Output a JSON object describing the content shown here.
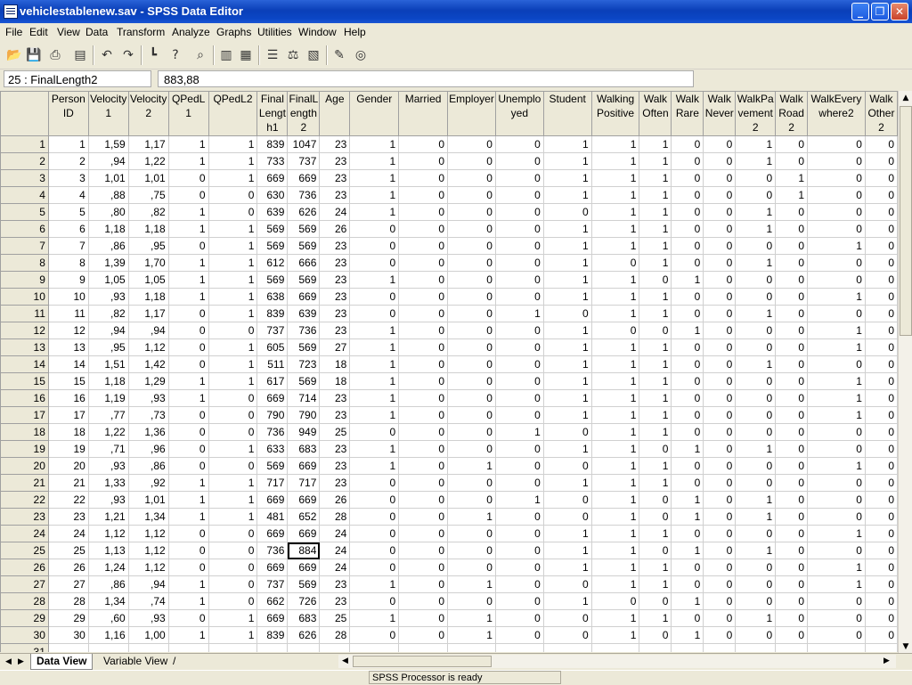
{
  "window": {
    "title": "vehiclestablenew.sav - SPSS Data Editor",
    "minimize": "_",
    "restore": "❐",
    "close": "✕"
  },
  "menu": [
    "File",
    "Edit",
    "View",
    "Data",
    "Transform",
    "Analyze",
    "Graphs",
    "Utilities",
    "Window",
    "Help"
  ],
  "editor": {
    "cell_ref": "25 : FinalLength2",
    "cell_value": "883,88"
  },
  "columns": [
    {
      "name": "Person ID",
      "w": 45
    },
    {
      "name": "Velocity1",
      "w": 45
    },
    {
      "name": "Velocity2",
      "w": 45
    },
    {
      "name": "QPedL1",
      "w": 45
    },
    {
      "name": "QPedL2",
      "w": 55
    },
    {
      "name": "FinalLength1",
      "w": 34
    },
    {
      "name": "FinalLength2",
      "w": 36
    },
    {
      "name": "Age",
      "w": 34
    },
    {
      "name": "Gender",
      "w": 55
    },
    {
      "name": "Married",
      "w": 55
    },
    {
      "name": "Employer",
      "w": 54
    },
    {
      "name": "Unemployed",
      "w": 54
    },
    {
      "name": "Student",
      "w": 54
    },
    {
      "name": "Walking Positive",
      "w": 54
    },
    {
      "name": "Walk Often",
      "w": 36
    },
    {
      "name": "Walk Rare",
      "w": 36
    },
    {
      "name": "Walk Never",
      "w": 36
    },
    {
      "name": "WalkPavement2",
      "w": 45
    },
    {
      "name": "Walk Road2",
      "w": 36
    },
    {
      "name": "WalkEverywhere2",
      "w": 65
    },
    {
      "name": "Walk Other2",
      "w": 36
    }
  ],
  "rows": [
    [
      "1",
      "1,59",
      "1,17",
      "1",
      "1",
      "839",
      "1047",
      "23",
      "1",
      "0",
      "0",
      "0",
      "1",
      "1",
      "1",
      "0",
      "0",
      "1",
      "0",
      "0",
      "0"
    ],
    [
      "2",
      ",94",
      "1,22",
      "1",
      "1",
      "733",
      "737",
      "23",
      "1",
      "0",
      "0",
      "0",
      "1",
      "1",
      "1",
      "0",
      "0",
      "1",
      "0",
      "0",
      "0"
    ],
    [
      "3",
      "1,01",
      "1,01",
      "0",
      "1",
      "669",
      "669",
      "23",
      "1",
      "0",
      "0",
      "0",
      "1",
      "1",
      "1",
      "0",
      "0",
      "0",
      "1",
      "0",
      "0"
    ],
    [
      "4",
      ",88",
      ",75",
      "0",
      "0",
      "630",
      "736",
      "23",
      "1",
      "0",
      "0",
      "0",
      "1",
      "1",
      "1",
      "0",
      "0",
      "0",
      "1",
      "0",
      "0"
    ],
    [
      "5",
      ",80",
      ",82",
      "1",
      "0",
      "639",
      "626",
      "24",
      "1",
      "0",
      "0",
      "0",
      "0",
      "1",
      "1",
      "0",
      "0",
      "1",
      "0",
      "0",
      "0"
    ],
    [
      "6",
      "1,18",
      "1,18",
      "1",
      "1",
      "569",
      "569",
      "26",
      "0",
      "0",
      "0",
      "0",
      "1",
      "1",
      "1",
      "0",
      "0",
      "1",
      "0",
      "0",
      "0"
    ],
    [
      "7",
      ",86",
      ",95",
      "0",
      "1",
      "569",
      "569",
      "23",
      "0",
      "0",
      "0",
      "0",
      "1",
      "1",
      "1",
      "0",
      "0",
      "0",
      "0",
      "1",
      "0"
    ],
    [
      "8",
      "1,39",
      "1,70",
      "1",
      "1",
      "612",
      "666",
      "23",
      "0",
      "0",
      "0",
      "0",
      "1",
      "0",
      "1",
      "0",
      "0",
      "1",
      "0",
      "0",
      "0"
    ],
    [
      "9",
      "1,05",
      "1,05",
      "1",
      "1",
      "569",
      "569",
      "23",
      "1",
      "0",
      "0",
      "0",
      "1",
      "1",
      "0",
      "1",
      "0",
      "0",
      "0",
      "0",
      "0"
    ],
    [
      "10",
      ",93",
      "1,18",
      "1",
      "1",
      "638",
      "669",
      "23",
      "0",
      "0",
      "0",
      "0",
      "1",
      "1",
      "1",
      "0",
      "0",
      "0",
      "0",
      "1",
      "0"
    ],
    [
      "11",
      ",82",
      "1,17",
      "0",
      "1",
      "839",
      "639",
      "23",
      "0",
      "0",
      "0",
      "1",
      "0",
      "1",
      "1",
      "0",
      "0",
      "1",
      "0",
      "0",
      "0"
    ],
    [
      "12",
      ",94",
      ",94",
      "0",
      "0",
      "737",
      "736",
      "23",
      "1",
      "0",
      "0",
      "0",
      "1",
      "0",
      "0",
      "1",
      "0",
      "0",
      "0",
      "1",
      "0"
    ],
    [
      "13",
      ",95",
      "1,12",
      "0",
      "1",
      "605",
      "569",
      "27",
      "1",
      "0",
      "0",
      "0",
      "1",
      "1",
      "1",
      "0",
      "0",
      "0",
      "0",
      "1",
      "0"
    ],
    [
      "14",
      "1,51",
      "1,42",
      "0",
      "1",
      "511",
      "723",
      "18",
      "1",
      "0",
      "0",
      "0",
      "1",
      "1",
      "1",
      "0",
      "0",
      "1",
      "0",
      "0",
      "0"
    ],
    [
      "15",
      "1,18",
      "1,29",
      "1",
      "1",
      "617",
      "569",
      "18",
      "1",
      "0",
      "0",
      "0",
      "1",
      "1",
      "1",
      "0",
      "0",
      "0",
      "0",
      "1",
      "0"
    ],
    [
      "16",
      "1,19",
      ",93",
      "1",
      "0",
      "669",
      "714",
      "23",
      "1",
      "0",
      "0",
      "0",
      "1",
      "1",
      "1",
      "0",
      "0",
      "0",
      "0",
      "1",
      "0"
    ],
    [
      "17",
      ",77",
      ",73",
      "0",
      "0",
      "790",
      "790",
      "23",
      "1",
      "0",
      "0",
      "0",
      "1",
      "1",
      "1",
      "0",
      "0",
      "0",
      "0",
      "1",
      "0"
    ],
    [
      "18",
      "1,22",
      "1,36",
      "0",
      "0",
      "736",
      "949",
      "25",
      "0",
      "0",
      "0",
      "1",
      "0",
      "1",
      "1",
      "0",
      "0",
      "0",
      "0",
      "0",
      "0"
    ],
    [
      "19",
      ",71",
      ",96",
      "0",
      "1",
      "633",
      "683",
      "23",
      "1",
      "0",
      "0",
      "0",
      "1",
      "1",
      "0",
      "1",
      "0",
      "1",
      "0",
      "0",
      "0"
    ],
    [
      "20",
      ",93",
      ",86",
      "0",
      "0",
      "569",
      "669",
      "23",
      "1",
      "0",
      "1",
      "0",
      "0",
      "1",
      "1",
      "0",
      "0",
      "0",
      "0",
      "1",
      "0"
    ],
    [
      "21",
      "1,33",
      ",92",
      "1",
      "1",
      "717",
      "717",
      "23",
      "0",
      "0",
      "0",
      "0",
      "1",
      "1",
      "1",
      "0",
      "0",
      "0",
      "0",
      "0",
      "0"
    ],
    [
      "22",
      ",93",
      "1,01",
      "1",
      "1",
      "669",
      "669",
      "26",
      "0",
      "0",
      "0",
      "1",
      "0",
      "1",
      "0",
      "1",
      "0",
      "1",
      "0",
      "0",
      "0"
    ],
    [
      "23",
      "1,21",
      "1,34",
      "1",
      "1",
      "481",
      "652",
      "28",
      "0",
      "0",
      "1",
      "0",
      "0",
      "1",
      "0",
      "1",
      "0",
      "1",
      "0",
      "0",
      "0"
    ],
    [
      "24",
      "1,12",
      "1,12",
      "0",
      "0",
      "669",
      "669",
      "24",
      "0",
      "0",
      "0",
      "0",
      "1",
      "1",
      "1",
      "0",
      "0",
      "0",
      "0",
      "1",
      "0"
    ],
    [
      "25",
      "1,13",
      "1,12",
      "0",
      "0",
      "736",
      "884",
      "24",
      "0",
      "0",
      "0",
      "0",
      "1",
      "1",
      "0",
      "1",
      "0",
      "1",
      "0",
      "0",
      "0"
    ],
    [
      "26",
      "1,24",
      "1,12",
      "0",
      "0",
      "669",
      "669",
      "24",
      "0",
      "0",
      "0",
      "0",
      "1",
      "1",
      "1",
      "0",
      "0",
      "0",
      "0",
      "1",
      "0"
    ],
    [
      "27",
      ",86",
      ",94",
      "1",
      "0",
      "737",
      "569",
      "23",
      "1",
      "0",
      "1",
      "0",
      "0",
      "1",
      "1",
      "0",
      "0",
      "0",
      "0",
      "1",
      "0"
    ],
    [
      "28",
      "1,34",
      ",74",
      "1",
      "0",
      "662",
      "726",
      "23",
      "0",
      "0",
      "0",
      "0",
      "1",
      "0",
      "0",
      "1",
      "0",
      "0",
      "0",
      "0",
      "0"
    ],
    [
      "29",
      ",60",
      ",93",
      "0",
      "1",
      "669",
      "683",
      "25",
      "1",
      "0",
      "1",
      "0",
      "0",
      "1",
      "1",
      "0",
      "0",
      "1",
      "0",
      "0",
      "0"
    ],
    [
      "30",
      "1,16",
      "1,00",
      "1",
      "1",
      "839",
      "626",
      "28",
      "0",
      "0",
      "1",
      "0",
      "0",
      "1",
      "0",
      "1",
      "0",
      "0",
      "0",
      "0",
      "0"
    ],
    [
      "",
      "",
      "",
      "",
      "",
      "",
      "",
      "",
      "",
      "",
      "",
      "",
      "",
      "",
      "",
      "",
      "",
      "",
      "",
      "",
      ""
    ]
  ],
  "row_headers": [
    "1",
    "2",
    "3",
    "4",
    "5",
    "6",
    "7",
    "8",
    "9",
    "10",
    "11",
    "12",
    "13",
    "14",
    "15",
    "16",
    "17",
    "18",
    "19",
    "20",
    "21",
    "22",
    "23",
    "24",
    "25",
    "26",
    "27",
    "28",
    "29",
    "30",
    "31"
  ],
  "active_cell": {
    "row": 24,
    "col": 6
  },
  "tabs": {
    "data_view": "Data View",
    "variable_view": "Variable View",
    "slash": "/"
  },
  "status": "SPSS Processor  is ready"
}
